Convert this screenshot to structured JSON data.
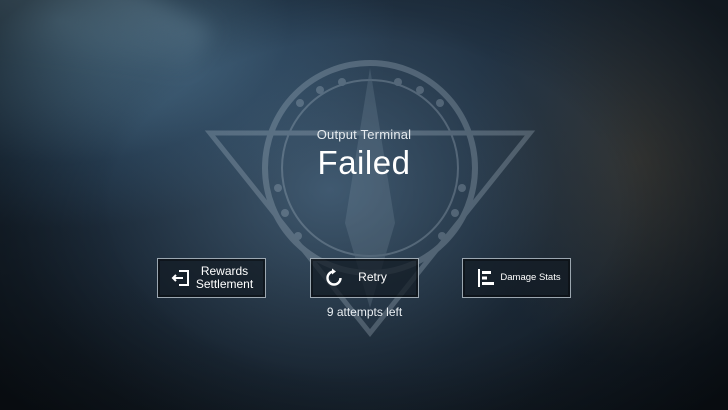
{
  "header": {
    "subtitle": "Output Terminal",
    "title": "Failed"
  },
  "actions": {
    "rewards": {
      "line1": "Rewards",
      "line2": "Settlement",
      "icon": "exit-icon"
    },
    "retry": {
      "label": "Retry",
      "icon": "retry-icon"
    },
    "damage": {
      "label": "Damage Stats",
      "icon": "bar-chart-icon"
    }
  },
  "attempts_text": "9 attempts left",
  "colors": {
    "button_border": "#c8d4de",
    "button_fill": "#121a22",
    "text": "#ffffff"
  }
}
